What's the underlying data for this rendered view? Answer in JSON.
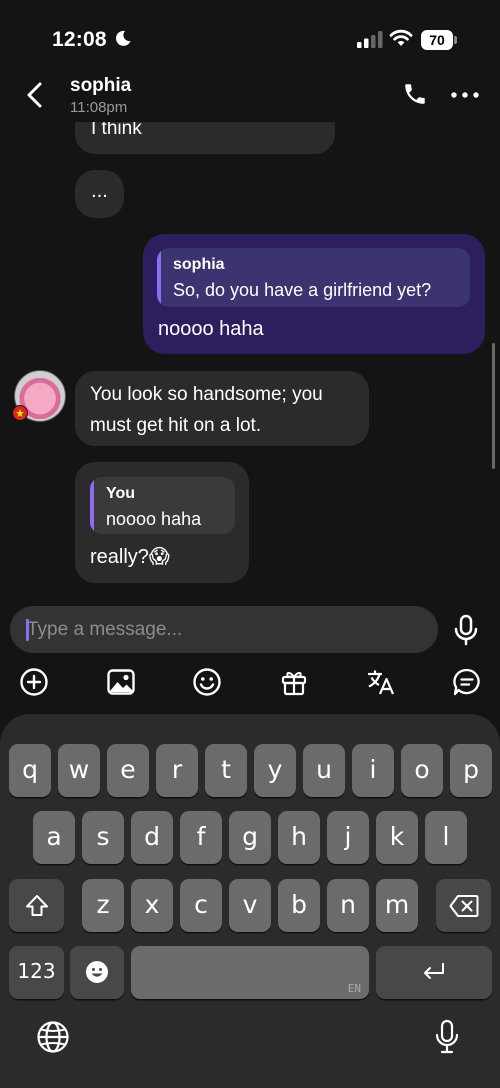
{
  "status_bar": {
    "time": "12:08",
    "battery": "70"
  },
  "header": {
    "contact_name": "sophia",
    "last_seen": "11:08pm"
  },
  "messages": [
    {
      "sender": "sophia",
      "text": "I think"
    },
    {
      "sender": "sophia",
      "text": "..."
    },
    {
      "sender": "You",
      "reply_to": {
        "name": "sophia",
        "text": "So, do you have a girlfriend yet?"
      },
      "text": "noooo haha"
    },
    {
      "sender": "sophia",
      "text": "You look so handsome; you must get hit on a lot."
    },
    {
      "sender": "sophia",
      "reply_to": {
        "name": "You",
        "text": "noooo haha"
      },
      "text": "really?😱"
    }
  ],
  "composer": {
    "placeholder": "Type a message..."
  },
  "toolbar": [
    "add-icon",
    "image-icon",
    "emoji-icon",
    "gift-icon",
    "translate-icon",
    "chat-bubble-icon"
  ],
  "keyboard": {
    "row1": [
      "q",
      "w",
      "e",
      "r",
      "t",
      "y",
      "u",
      "i",
      "o",
      "p"
    ],
    "row2": [
      "a",
      "s",
      "d",
      "f",
      "g",
      "h",
      "j",
      "k",
      "l"
    ],
    "row3": [
      "z",
      "x",
      "c",
      "v",
      "b",
      "n",
      "m"
    ],
    "numbers_key": "123",
    "space_lang": "EN"
  },
  "colors": {
    "accent": "#8b6cf2",
    "sent_bubble": "#2d1f5f",
    "received_bubble": "#2b2b2b"
  }
}
